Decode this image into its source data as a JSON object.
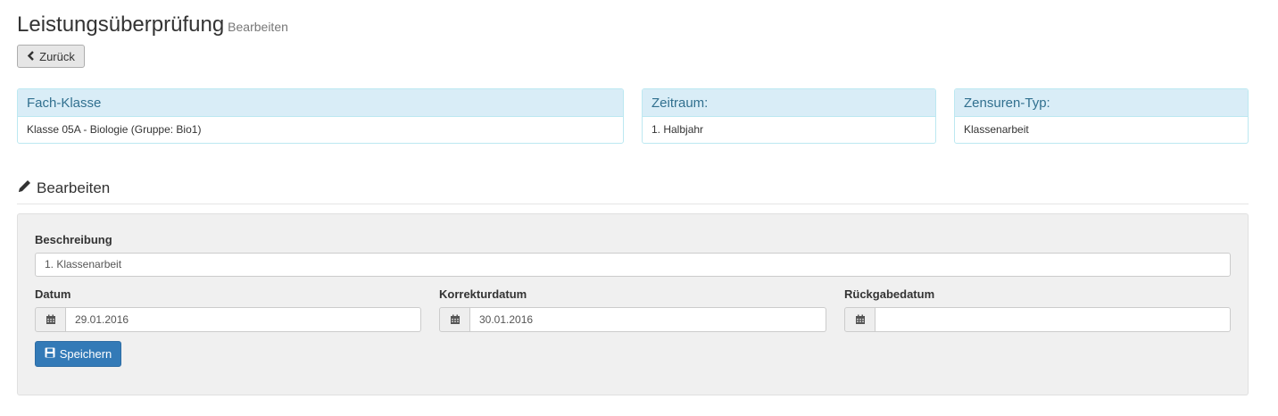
{
  "header": {
    "title": "Leistungsüberprüfung",
    "subtitle": "Bearbeiten"
  },
  "back_button": {
    "label": "Zurück",
    "icon": "chevron-left-icon"
  },
  "panels": [
    {
      "heading": "Fach-Klasse",
      "value": "Klasse 05A - Biologie (Gruppe: Bio1)"
    },
    {
      "heading": "Zeitraum:",
      "value": "1. Halbjahr"
    },
    {
      "heading": "Zensuren-Typ:",
      "value": "Klassenarbeit"
    }
  ],
  "section": {
    "title": "Bearbeiten",
    "icon": "pencil-icon"
  },
  "form": {
    "beschreibung": {
      "label": "Beschreibung",
      "value": "1. Klassenarbeit"
    },
    "datum": {
      "label": "Datum",
      "value": "29.01.2016",
      "icon": "calendar-icon"
    },
    "korrekturdatum": {
      "label": "Korrekturdatum",
      "value": "30.01.2016",
      "icon": "calendar-icon"
    },
    "rueckgabedatum": {
      "label": "Rückgabedatum",
      "value": "",
      "icon": "calendar-icon"
    },
    "save_button": {
      "label": "Speichern",
      "icon": "floppy-disk-icon"
    }
  },
  "colors": {
    "panel_heading_bg": "#d9edf7",
    "panel_heading_text": "#31708f",
    "panel_border": "#bce8f1",
    "primary": "#337ab7",
    "well_bg": "#f0f0f0"
  }
}
